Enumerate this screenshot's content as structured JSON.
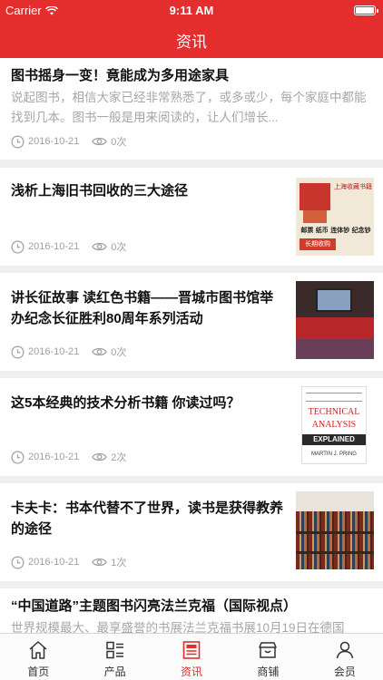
{
  "status": {
    "carrier": "Carrier",
    "time": "9:11 AM"
  },
  "header": {
    "title": "资讯"
  },
  "articles": [
    {
      "title": "图书摇身一变！竟能成为多用途家具",
      "summary": "说起图书，相信大家已经非常熟悉了，或多或少，每个家庭中都能找到几本。图书一般是用来阅读的，让人们增长...",
      "date": "2016-10-21",
      "views": "0次"
    },
    {
      "title": "浅析上海旧书回收的三大途径",
      "date": "2016-10-21",
      "views": "0次",
      "thumb_text": [
        "上海收藏书籍",
        "邮票 纸币 连体钞 纪念钞",
        "长期收购"
      ]
    },
    {
      "title": "讲长征故事 读红色书籍——晋城市图书馆举办纪念长征胜利80周年系列活动",
      "date": "2016-10-21",
      "views": "0次"
    },
    {
      "title": "这5本经典的技术分析书籍 你读过吗？",
      "date": "2016-10-21",
      "views": "2次",
      "thumb_text": [
        "TECHNICAL",
        "ANALYSIS",
        "EXPLAINED",
        "MARTIN J. PRING"
      ]
    },
    {
      "title": "卡夫卡：书本代替不了世界，读书是获得教养的途径",
      "date": "2016-10-21",
      "views": "1次"
    },
    {
      "title": "“中国道路”主题图书闪亮法兰克福（国际视点）",
      "summary": "世界规模最大、最享盛誉的书展法兰克福书展10月19日在德国"
    }
  ],
  "tabs": [
    {
      "label": "首页",
      "icon": "home-icon"
    },
    {
      "label": "产品",
      "icon": "list-icon"
    },
    {
      "label": "资讯",
      "icon": "news-icon",
      "active": true
    },
    {
      "label": "商铺",
      "icon": "shop-icon"
    },
    {
      "label": "会员",
      "icon": "user-icon"
    }
  ],
  "colors": {
    "brand": "#e42d2d",
    "meta": "#a0a0a0"
  }
}
